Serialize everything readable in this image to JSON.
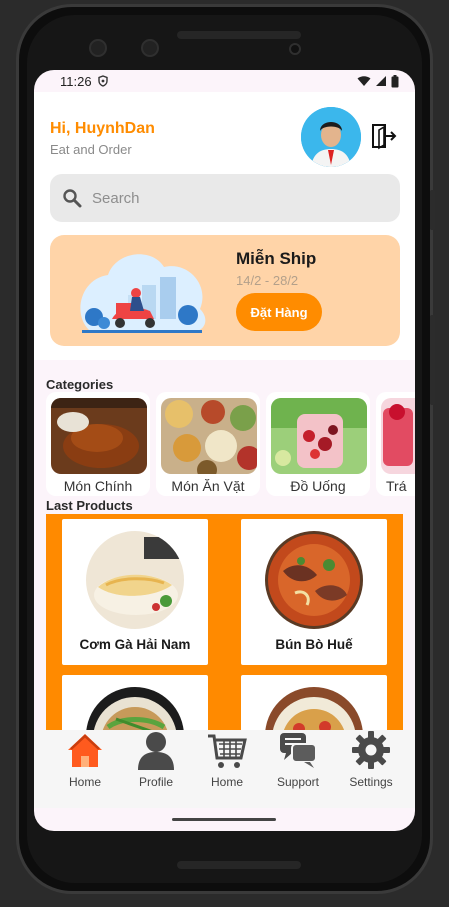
{
  "status_bar": {
    "time": "11:26"
  },
  "header": {
    "greeting": "Hi, HuynhDan",
    "subtitle": "Eat and Order"
  },
  "search": {
    "placeholder": "Search"
  },
  "banner": {
    "title": "Miễn Ship",
    "dates": "14/2 - 28/2",
    "button_label": "Đặt Hàng"
  },
  "categories": {
    "title": "Categories",
    "items": [
      {
        "label": "Món Chính"
      },
      {
        "label": "Món Ăn Vặt"
      },
      {
        "label": "Đồ Uống"
      },
      {
        "label": "Trá"
      }
    ]
  },
  "products": {
    "title": "Last Products",
    "items": [
      {
        "name": "Cơm Gà Hải Nam"
      },
      {
        "name": "Bún Bò Huế"
      },
      {
        "name": ""
      },
      {
        "name": ""
      }
    ]
  },
  "tabbar": {
    "items": [
      {
        "label": "Home",
        "icon": "house-icon",
        "active": true
      },
      {
        "label": "Profile",
        "icon": "person-icon"
      },
      {
        "label": "Home",
        "icon": "cart-icon"
      },
      {
        "label": "Support",
        "icon": "chat-icon"
      },
      {
        "label": "Settings",
        "icon": "gear-icon"
      }
    ]
  },
  "colors": {
    "accent": "#ff8c00",
    "banner_bg": "#ffd4a8",
    "screen_bg": "#fcf4fa"
  }
}
